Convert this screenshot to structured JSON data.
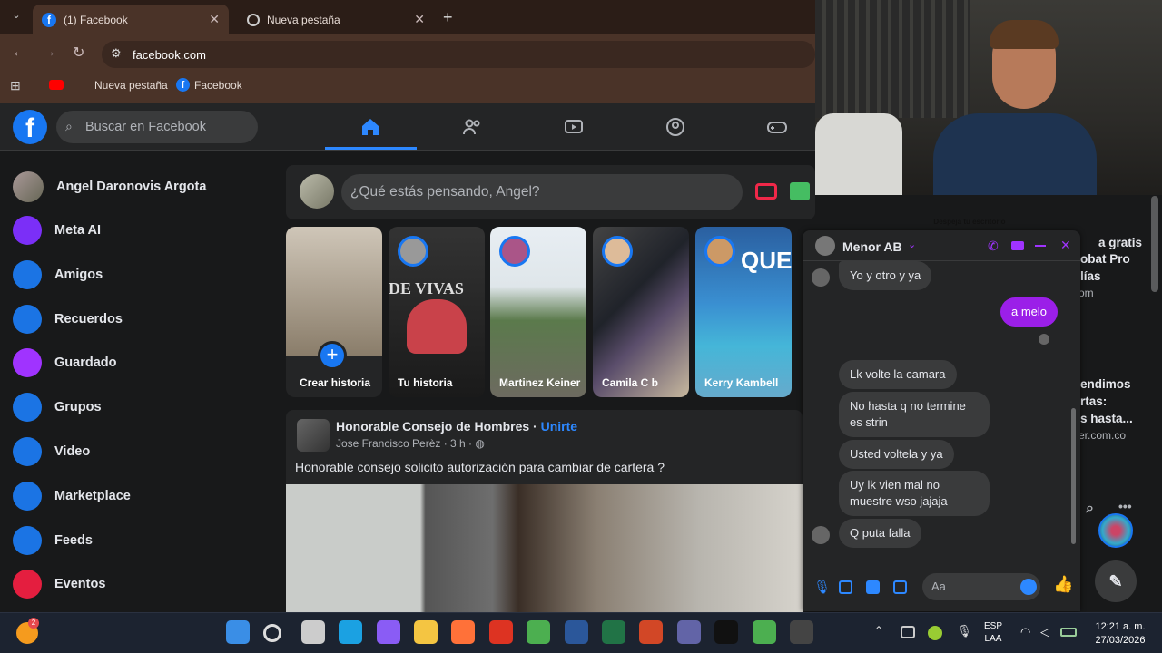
{
  "browser": {
    "tabs": [
      {
        "label": "(1) Facebook"
      },
      {
        "label": "Nueva pestaña"
      }
    ],
    "url": "facebook.com",
    "bookmarks": [
      "Nueva pestaña",
      "Facebook"
    ]
  },
  "fb": {
    "search_placeholder": "Buscar en Facebook",
    "user": "Angel Daronovis Argota",
    "sidebar": [
      {
        "label": "Meta AI",
        "icon": "meta-ai-icon",
        "color": "#7b2ff7"
      },
      {
        "label": "Amigos",
        "icon": "friends-icon",
        "color": "#1b74e4"
      },
      {
        "label": "Recuerdos",
        "icon": "memories-icon",
        "color": "#1b74e4"
      },
      {
        "label": "Guardado",
        "icon": "saved-icon",
        "color": "#a033ff"
      },
      {
        "label": "Grupos",
        "icon": "groups-icon",
        "color": "#1b74e4"
      },
      {
        "label": "Video",
        "icon": "video-icon",
        "color": "#1b74e4"
      },
      {
        "label": "Marketplace",
        "icon": "marketplace-icon",
        "color": "#1b74e4"
      },
      {
        "label": "Feeds",
        "icon": "feeds-icon",
        "color": "#1b74e4"
      },
      {
        "label": "Eventos",
        "icon": "events-icon",
        "color": "#e41e3f"
      }
    ],
    "composer_placeholder": "¿Qué estás pensando, Angel?",
    "stories": [
      {
        "label": "Crear historia"
      },
      {
        "label": "Tu historia"
      },
      {
        "label": "Martinez Keiner"
      },
      {
        "label": "Camila C b"
      },
      {
        "label": "Kerry Kambell"
      }
    ],
    "story_overlays": {
      "s2": "DE VIVAS",
      "s5": "QUE"
    },
    "post": {
      "group": "Honorable Consejo de Hombres",
      "join": "Unirte",
      "meta": "Jose Francisco Perèz · 3 h ·",
      "text": "Honorable consejo solicito autorización para cambiar de cartera ?"
    },
    "right_partial": [
      "a gratis",
      "obat Pro",
      "lías",
      "om",
      "endimos",
      "rtas:",
      "s hasta...",
      "er.com.co"
    ]
  },
  "camera": {
    "sign": "Despeja tu escritorio"
  },
  "chat": {
    "name": "Menor AB",
    "messages": [
      {
        "from": "them",
        "text": "Yo y otro y ya"
      },
      {
        "from": "me",
        "text": "a melo"
      },
      {
        "from": "them",
        "text": "Lk volte la camara"
      },
      {
        "from": "them",
        "text": "No hasta q no termine es strin"
      },
      {
        "from": "them",
        "text": "Usted voltela y ya"
      },
      {
        "from": "them",
        "text": "Uy lk vien mal no muestre wso jajaja"
      },
      {
        "from": "them",
        "text": "Q puta falla"
      }
    ],
    "input_placeholder": "Aa"
  },
  "taskbar": {
    "lang1": "ESP",
    "lang2": "LAA",
    "time": "12:21 a. m.",
    "date": "27/03/2026",
    "badge": "2"
  }
}
